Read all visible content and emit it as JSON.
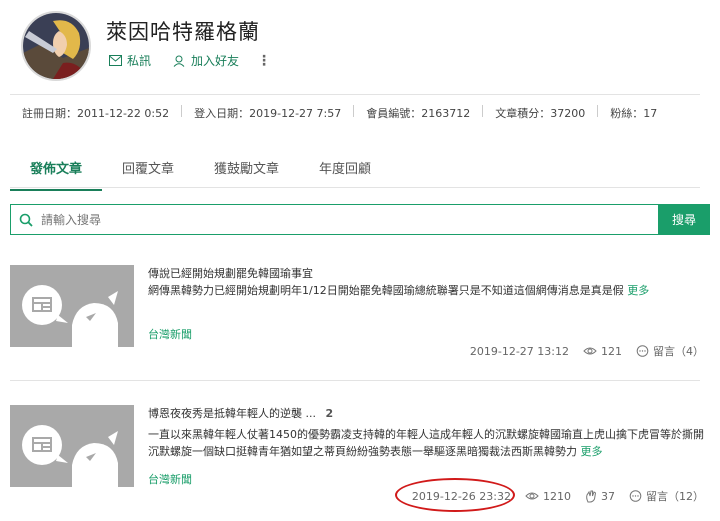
{
  "profile": {
    "username": "萊因哈特羅格蘭",
    "message_label": "私訊",
    "add_friend_label": "加入好友",
    "more_label": "⋮"
  },
  "stats": [
    {
      "label": "註冊日期：2011-12-22 0:52"
    },
    {
      "label": "登入日期：2019-12-27 7:57"
    },
    {
      "label": "會員編號：2163712"
    },
    {
      "label": "文章積分：37200"
    },
    {
      "label": "粉絲：17"
    }
  ],
  "tabs": [
    {
      "label": "發佈文章",
      "active": true
    },
    {
      "label": "回覆文章",
      "active": false
    },
    {
      "label": "獲鼓勵文章",
      "active": false
    },
    {
      "label": "年度回顧",
      "active": false
    }
  ],
  "search": {
    "placeholder": "請輸入搜尋",
    "button_label": "搜尋"
  },
  "posts": [
    {
      "title": "傳說已經開始規劃罷免韓國瑜事宜",
      "excerpt": "網傳黑韓勢力已經開始規劃明年1/12日開始罷免韓國瑜總統聯署只是不知道這個網傳消息是真是假",
      "more_label": "更多",
      "source": "台灣新聞",
      "timestamp": "2019-12-27 13:12",
      "views": "121",
      "comments": "留言（4）"
    },
    {
      "title": "博恩夜夜秀是抵韓年輕人的逆襲",
      "title_ellipsis": "...",
      "title_count": "2",
      "excerpt": "一直以來黑韓年輕人仗著1450的優勢霸凌支持韓的年輕人這成年輕人的沉默螺旋韓國瑜直上虎山擒下虎冒等於撕開沉默螺旋一個缺口挺韓青年猶如望之蒂頁紛紛強勢表態一舉驅逐黑暗獨裁法西斯黑韓勢力",
      "more_label": "更多",
      "source": "台灣新聞",
      "timestamp": "2019-12-26 23:32",
      "views": "1210",
      "likes": "37",
      "comments": "留言（12）"
    }
  ],
  "colors": {
    "accent": "#1a9e6a",
    "highlight": "#d11a1a"
  }
}
